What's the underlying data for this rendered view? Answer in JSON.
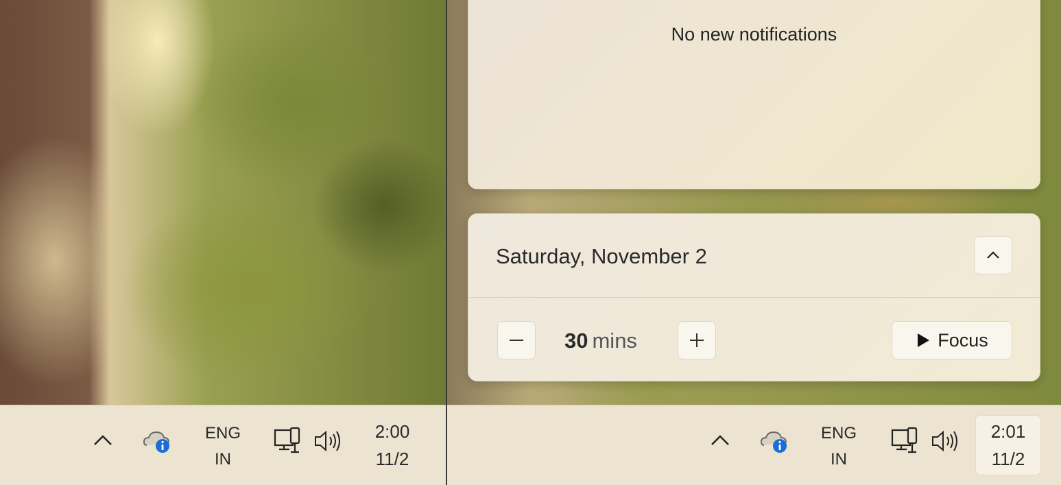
{
  "left_screen": {
    "taskbar": {
      "language": {
        "line1": "ENG",
        "line2": "IN"
      },
      "clock": {
        "time": "2:00",
        "date": "11/2"
      }
    }
  },
  "right_screen": {
    "notification_center": {
      "empty_message": "No new notifications"
    },
    "calendar": {
      "date_label": "Saturday, November 2",
      "focus": {
        "duration_value": "30",
        "duration_unit": "mins",
        "start_label": "Focus"
      }
    },
    "taskbar": {
      "language": {
        "line1": "ENG",
        "line2": "IN"
      },
      "clock": {
        "time": "2:01",
        "date": "11/2"
      }
    }
  },
  "icons": {
    "tray_overflow": "chevron-up-icon",
    "cloud": "onedrive-info-icon",
    "network": "network-icon",
    "volume": "volume-icon",
    "collapse": "chevron-up-icon",
    "decrease": "minus-icon",
    "increase": "plus-icon",
    "play": "play-icon"
  },
  "colors": {
    "info_badge": "#1a6fd6",
    "panel_bg": "#efe8d6",
    "taskbar_bg": "#ece4d0"
  }
}
